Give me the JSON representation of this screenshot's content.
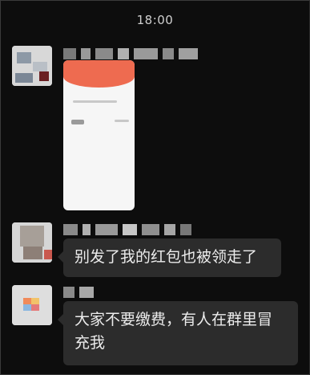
{
  "status_bar": {
    "time": "18:00"
  },
  "messages": [
    {
      "type": "image",
      "sender_name_hidden": true
    },
    {
      "type": "text",
      "text": "别发了我的红包也被领走了"
    },
    {
      "type": "text",
      "text": "大家不要缴费，有人在群里冒充我"
    }
  ],
  "colors": {
    "background": "#0d0d0d",
    "bubble": "#2c2c2c",
    "red_packet_header": "#ee6b50"
  }
}
